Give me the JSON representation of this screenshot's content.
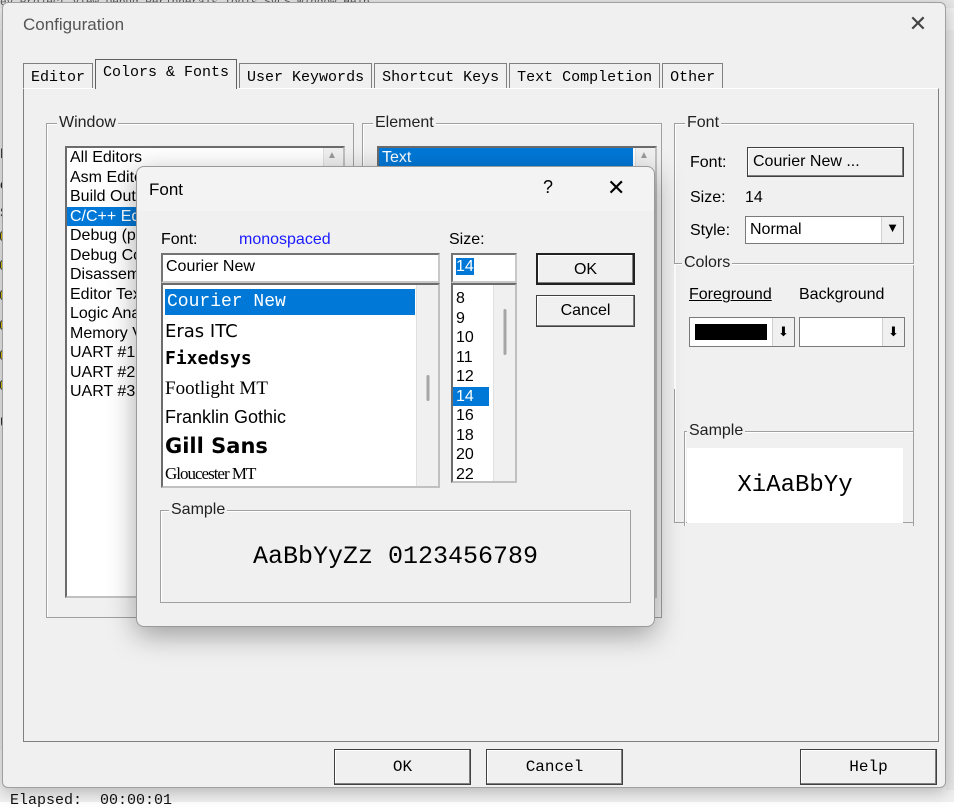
{
  "config": {
    "title": "Configuration",
    "tabs": [
      "Editor",
      "Colors & Fonts",
      "User Keywords",
      "Shortcut Keys",
      "Text Completion",
      "Other"
    ],
    "active_tab": "Colors & Fonts",
    "window_group": {
      "label": "Window",
      "items": [
        "All Editors",
        "Asm Edito",
        "Build Outp",
        "C/C++ Ed",
        "Debug (pi",
        "Debug Co",
        "Disassem",
        "Editor Tex",
        "Logic Ana",
        "Memory V",
        "UART #1",
        "UART #2",
        "UART #3"
      ],
      "selected": "C/C++ Ed"
    },
    "element_group": {
      "label": "Element",
      "items": [
        "Text"
      ],
      "selected": "Text"
    },
    "font_group": {
      "label": "Font",
      "font_label": "Font:",
      "font_button": "Courier New ...",
      "size_label": "Size:",
      "size_value": "14",
      "style_label": "Style:",
      "style_value": "Normal"
    },
    "colors_group": {
      "label": "Colors",
      "foreground_label": "Foreground",
      "background_label": "Background",
      "foreground_color": "#000000",
      "background_color": "#ffffff"
    },
    "sample_group": {
      "label": "Sample",
      "text": "XiAaBbYy"
    },
    "buttons": {
      "ok": "OK",
      "cancel": "Cancel",
      "help": "Help"
    }
  },
  "font_dialog": {
    "title": "Font",
    "help": "?",
    "close": "✕",
    "font_label": "Font:",
    "font_hint": "monospaced",
    "font_value": "Courier New",
    "size_label": "Size:",
    "size_value": "14",
    "fonts": [
      "Courier New",
      "Eras ITC",
      "Fixedsys",
      "Footlight MT",
      "Franklin Gothic",
      "Gill Sans",
      "Gloucester MT"
    ],
    "selected_font": "Courier New",
    "sizes": [
      "8",
      "9",
      "10",
      "11",
      "12",
      "14",
      "16",
      "18",
      "20",
      "22"
    ],
    "selected_size": "14",
    "ok": "OK",
    "cancel": "Cancel",
    "sample_label": "Sample",
    "sample_text": "AaBbYyZz 0123456789"
  },
  "background": {
    "elapsed": "Elapsed:  00:00:01"
  }
}
